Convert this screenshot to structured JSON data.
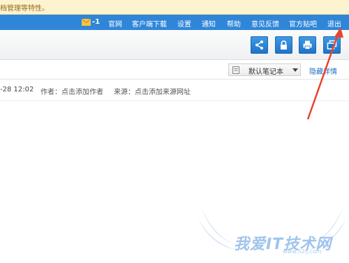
{
  "notice": {
    "text": "档管理等特性。"
  },
  "nav": {
    "mail_count": "-1",
    "items": [
      "官网",
      "客户端下载",
      "设置",
      "通知",
      "帮助",
      "意见反馈",
      "官方贴吧",
      "退出"
    ]
  },
  "toolbar": {
    "buttons": [
      "share-icon",
      "lock-icon",
      "print-icon",
      "window-icon"
    ]
  },
  "notebook": {
    "selected": "默认笔记本",
    "hide_detail": "隐藏详情"
  },
  "meta": {
    "date": "-28 12:02",
    "author": "作者：点击添加作者",
    "source": "来源：点击添加来源网址"
  },
  "watermark": {
    "text": "我爱IT技术网",
    "sub": "www.52ij.com"
  },
  "colors": {
    "nav_bg": "#2f86d9",
    "notice_bg": "#fdf3cf",
    "arrow": "#e8432e",
    "link": "#1f6fc4"
  }
}
